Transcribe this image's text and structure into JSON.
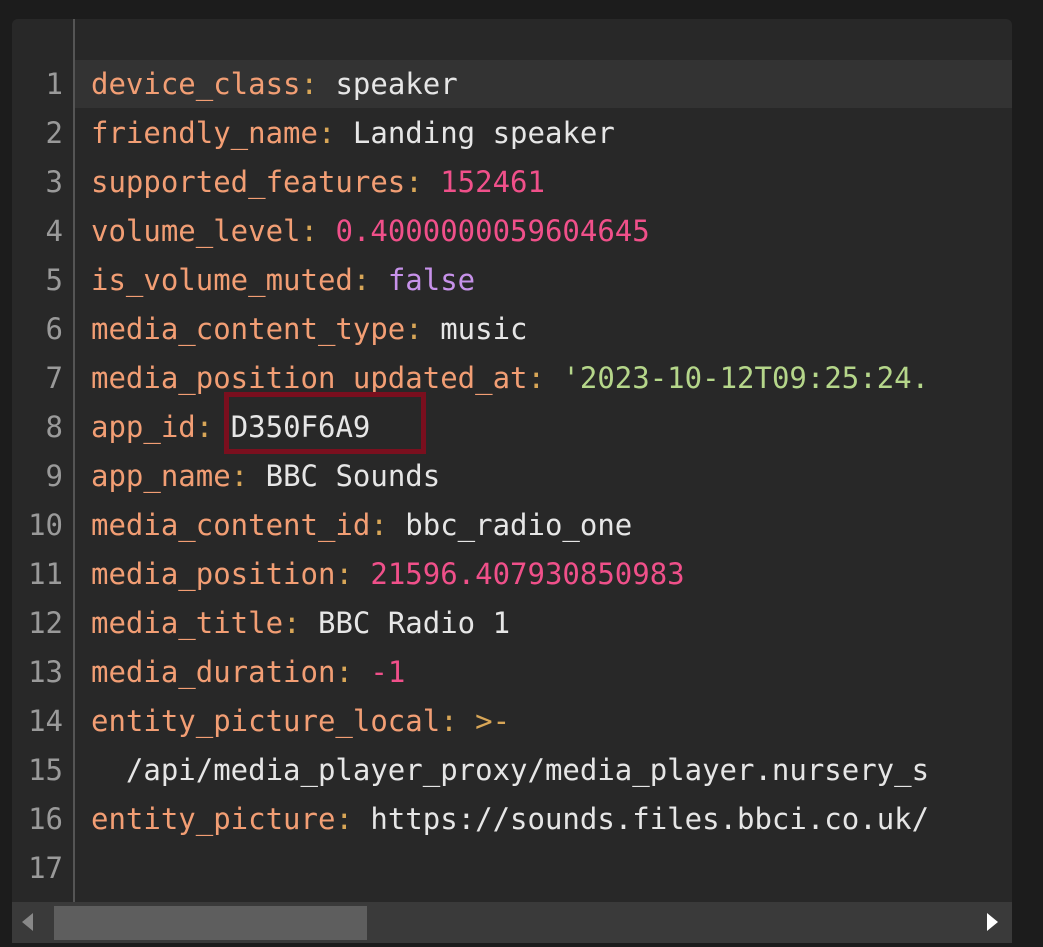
{
  "editor": {
    "lines": [
      {
        "num": "1",
        "key": "device_class",
        "sep": ":",
        "value": " speaker",
        "type": "s"
      },
      {
        "num": "2",
        "key": "friendly_name",
        "sep": ":",
        "value": " Landing speaker",
        "type": "s"
      },
      {
        "num": "3",
        "key": "supported_features",
        "sep": ":",
        "value": " 152461",
        "type": "n"
      },
      {
        "num": "4",
        "key": "volume_level",
        "sep": ":",
        "value": " 0.4000000059604645",
        "type": "n"
      },
      {
        "num": "5",
        "key": "is_volume_muted",
        "sep": ":",
        "value": " false",
        "type": "b"
      },
      {
        "num": "6",
        "key": "media_content_type",
        "sep": ":",
        "value": " music",
        "type": "s"
      },
      {
        "num": "7",
        "key": "media_position_updated_at",
        "sep": ":",
        "value": " '2023-10-12T09:25:24.",
        "type": "q"
      },
      {
        "num": "8",
        "key": "app_id",
        "sep": ":",
        "value": " D350F6A9",
        "type": "s"
      },
      {
        "num": "9",
        "key": "app_name",
        "sep": ":",
        "value": " BBC Sounds",
        "type": "s"
      },
      {
        "num": "10",
        "key": "media_content_id",
        "sep": ":",
        "value": " bbc_radio_one",
        "type": "s"
      },
      {
        "num": "11",
        "key": "media_position",
        "sep": ":",
        "value": " 21596.407930850983",
        "type": "n"
      },
      {
        "num": "12",
        "key": "media_title",
        "sep": ":",
        "value": " BBC Radio 1",
        "type": "s"
      },
      {
        "num": "13",
        "key": "media_duration",
        "sep": ":",
        "value": " -1",
        "type": "n"
      },
      {
        "num": "14",
        "key": "entity_picture_local",
        "sep": ":",
        "value": " >-",
        "type": "p"
      },
      {
        "num": "15",
        "key": "",
        "sep": "",
        "value": "  /api/media_player_proxy/media_player.nursery_s",
        "type": "s"
      },
      {
        "num": "16",
        "key": "entity_picture",
        "sep": ":",
        "value": " https://sounds.files.bbci.co.uk/",
        "type": "s"
      },
      {
        "num": "17",
        "key": "",
        "sep": "",
        "value": "",
        "type": "s"
      }
    ]
  },
  "colors": {
    "background": "#282828",
    "key": "#f29e74",
    "number": "#f0508a",
    "boolean": "#c792ea",
    "quoted_string": "#b5d68a",
    "highlight_box": "#7a0f1e"
  },
  "icons": {
    "scroll_left": "triangle-left-icon",
    "scroll_right": "triangle-right-icon"
  }
}
